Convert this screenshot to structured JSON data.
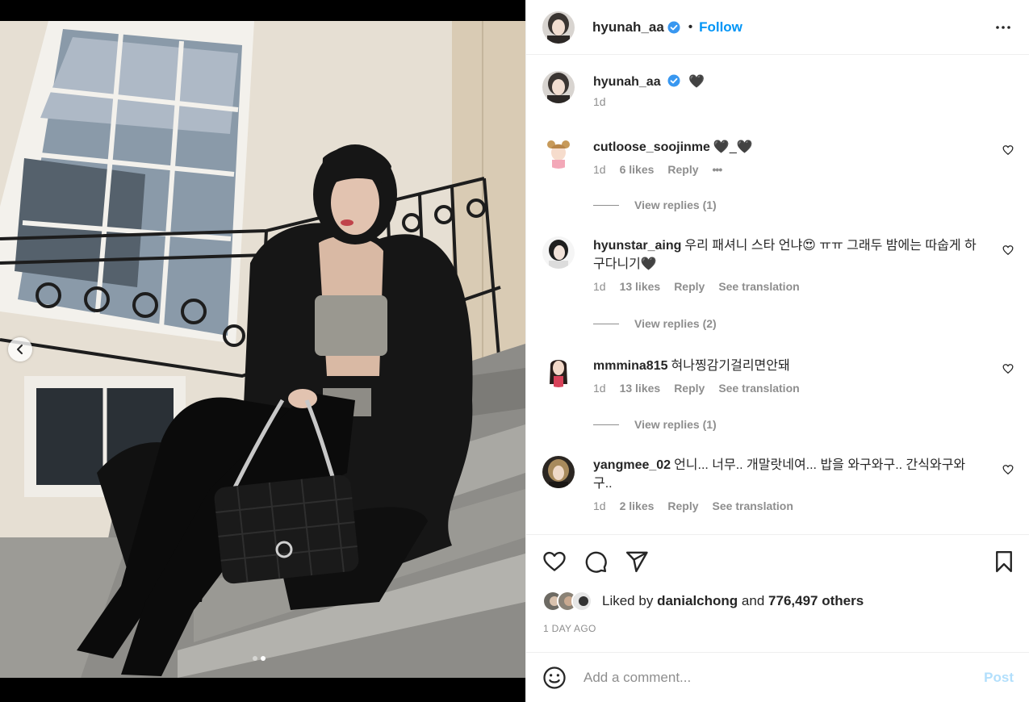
{
  "post": {
    "author": "hyunah_aa",
    "follow_label": "Follow",
    "separator": "•",
    "caption": "🖤",
    "caption_time": "1d"
  },
  "comments": [
    {
      "username": "cutloose_soojinme",
      "text": "🖤_🖤",
      "time": "1d",
      "likes": "6 likes",
      "reply": "Reply",
      "more": "•••",
      "view_replies": "View replies (1)"
    },
    {
      "username": "hyunstar_aing",
      "text": "우리 패셔니 스타 언냐😍 ㅠㅠ 그래두 밤에는 따숩게 하구다니기🖤",
      "time": "1d",
      "likes": "13 likes",
      "reply": "Reply",
      "translate": "See translation",
      "view_replies": "View replies (2)"
    },
    {
      "username": "mmmina815",
      "text": "혀나찡감기걸리면안돼",
      "time": "1d",
      "likes": "13 likes",
      "reply": "Reply",
      "translate": "See translation",
      "view_replies": "View replies (1)"
    },
    {
      "username": "yangmee_02",
      "text": "언니... 너무.. 개말랏네여... 밥을 와구와구.. 간식와구와구..",
      "time": "1d",
      "likes": "2 likes",
      "reply": "Reply",
      "translate": "See translation"
    }
  ],
  "likes": {
    "prefix": "Liked by",
    "user": "danialchong",
    "and": "and",
    "count": "776,497 others"
  },
  "date": "1 DAY AGO",
  "composer": {
    "placeholder": "Add a comment...",
    "post_label": "Post"
  },
  "icons": {
    "verified": "verified-badge-icon",
    "more": "more-options-icon",
    "heart": "heart-icon",
    "comment": "comment-icon",
    "share": "share-icon",
    "save": "bookmark-icon",
    "emoji": "emoji-icon",
    "prev": "chevron-left-icon"
  },
  "colors": {
    "accent": "#0095f6",
    "post_disabled": "#b2dffc",
    "muted": "#8e8e8e",
    "text": "#262626"
  }
}
